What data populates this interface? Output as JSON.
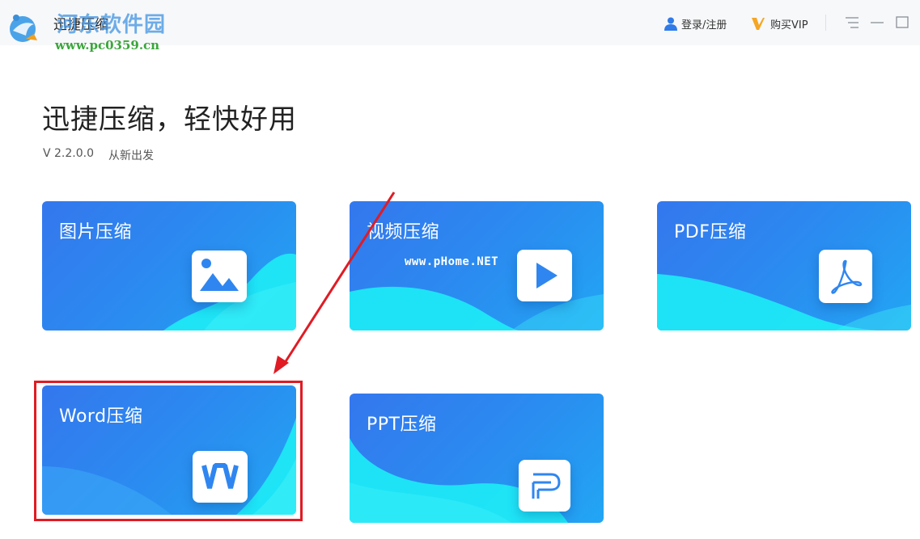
{
  "titlebar": {
    "app_title": "迅捷压缩",
    "login_label": "登录/注册",
    "vip_label": "购买VIP"
  },
  "watermark": {
    "site_name": "河东软件园",
    "site_url": "www.pc0359.cn",
    "phome": "www.pHome.NET"
  },
  "header": {
    "headline": "迅捷压缩，轻快好用",
    "version": "V 2.2.0.0",
    "slogan": "从新出发"
  },
  "cards": [
    {
      "label": "图片压缩",
      "icon": "image-icon"
    },
    {
      "label": "视频压缩",
      "icon": "play-icon"
    },
    {
      "label": "PDF压缩",
      "icon": "pdf-icon"
    },
    {
      "label": "Word压缩",
      "icon": "word-icon"
    },
    {
      "label": "PPT压缩",
      "icon": "ppt-icon"
    }
  ],
  "colors": {
    "card_gradient_start": "#3477ee",
    "card_gradient_end": "#22a6f4",
    "wave_light": "#1ee8f5",
    "annotation_red": "#e01b24",
    "vip_orange": "#f5a623",
    "user_blue": "#2f7be8"
  }
}
